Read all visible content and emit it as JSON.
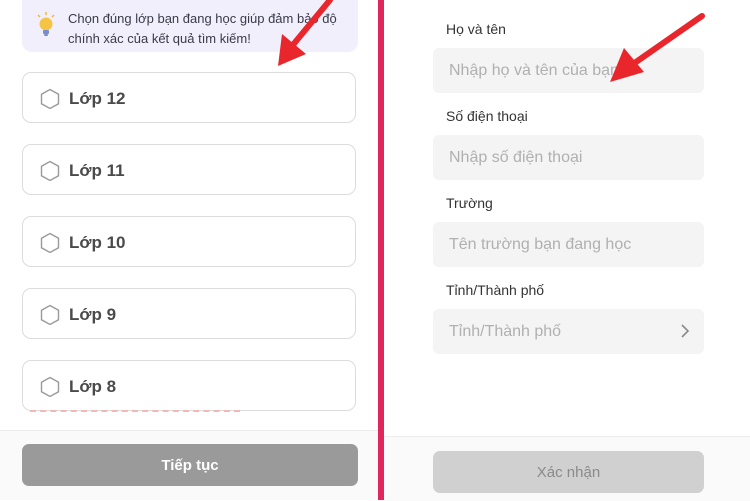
{
  "class_select": {
    "hint_text": "Chọn đúng lớp bạn đang học giúp đảm bảo độ chính xác của kết quả tìm kiếm!",
    "options": [
      {
        "label": "Lớp 12"
      },
      {
        "label": "Lớp 11"
      },
      {
        "label": "Lớp 10"
      },
      {
        "label": "Lớp 9"
      },
      {
        "label": "Lớp 8"
      }
    ],
    "continue_label": "Tiếp tục"
  },
  "profile_form": {
    "fields": [
      {
        "label": "Họ và tên",
        "placeholder": "Nhập họ và tên của bạn"
      },
      {
        "label": "Số điện thoại",
        "placeholder": "Nhập số điện thoại"
      },
      {
        "label": "Trường",
        "placeholder": "Tên trường bạn đang học"
      },
      {
        "label": "Tỉnh/Thành phố",
        "placeholder": "Tỉnh/Thành phố"
      }
    ],
    "confirm_label": "Xác nhận"
  },
  "colors": {
    "divider": "#e0265d",
    "annotation_arrow": "#e8262c",
    "hint_background": "#f1effb",
    "continue_button": "#9a9a9a",
    "confirm_button": "#d0d0d0"
  },
  "icons": {
    "hint": "lightbulb-icon",
    "option": "hexagon-icon",
    "select": "chevron-right-icon"
  }
}
